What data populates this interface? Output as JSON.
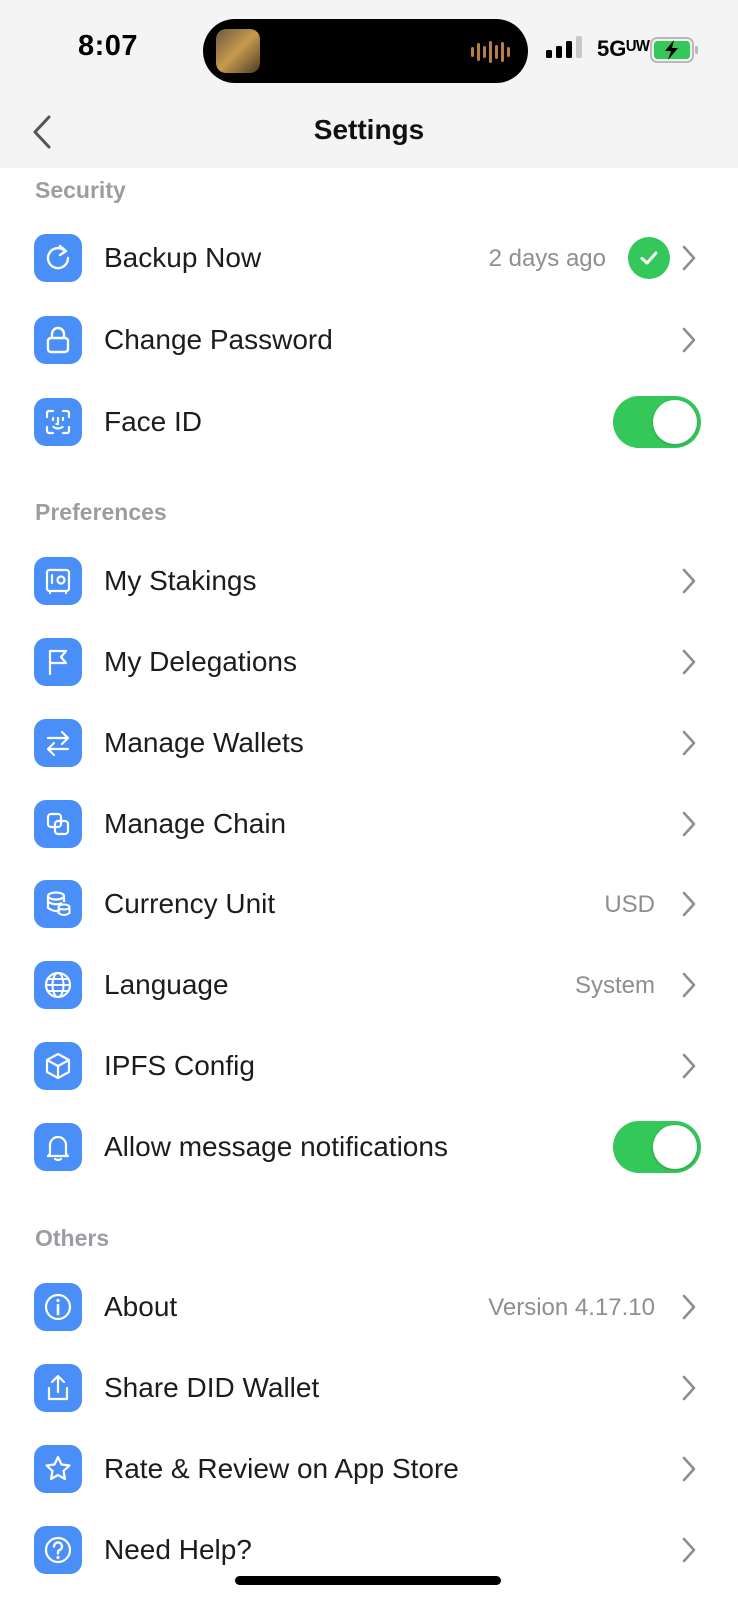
{
  "status_bar": {
    "time": "8:07",
    "network": "5Gᵁᵂ"
  },
  "nav": {
    "title": "Settings"
  },
  "sections": {
    "security": {
      "header": "Security",
      "backup_now": {
        "label": "Backup Now",
        "value": "2 days ago"
      },
      "change_password": {
        "label": "Change Password"
      },
      "face_id": {
        "label": "Face ID",
        "enabled": true
      }
    },
    "preferences": {
      "header": "Preferences",
      "my_stakings": {
        "label": "My Stakings"
      },
      "my_delegations": {
        "label": "My Delegations"
      },
      "manage_wallets": {
        "label": "Manage Wallets"
      },
      "manage_chain": {
        "label": "Manage Chain"
      },
      "currency_unit": {
        "label": "Currency Unit",
        "value": "USD"
      },
      "language": {
        "label": "Language",
        "value": "System"
      },
      "ipfs_config": {
        "label": "IPFS Config"
      },
      "notifications": {
        "label": "Allow message notifications",
        "enabled": true
      }
    },
    "others": {
      "header": "Others",
      "about": {
        "label": "About",
        "value": "Version 4.17.10"
      },
      "share_did": {
        "label": "Share DID Wallet"
      },
      "rate_review": {
        "label": "Rate & Review on App Store"
      },
      "need_help": {
        "label": "Need Help?"
      }
    }
  },
  "colors": {
    "accent": "#4a8ef7",
    "toggle_on": "#34c759",
    "secondary_text": "#8e8e93"
  }
}
